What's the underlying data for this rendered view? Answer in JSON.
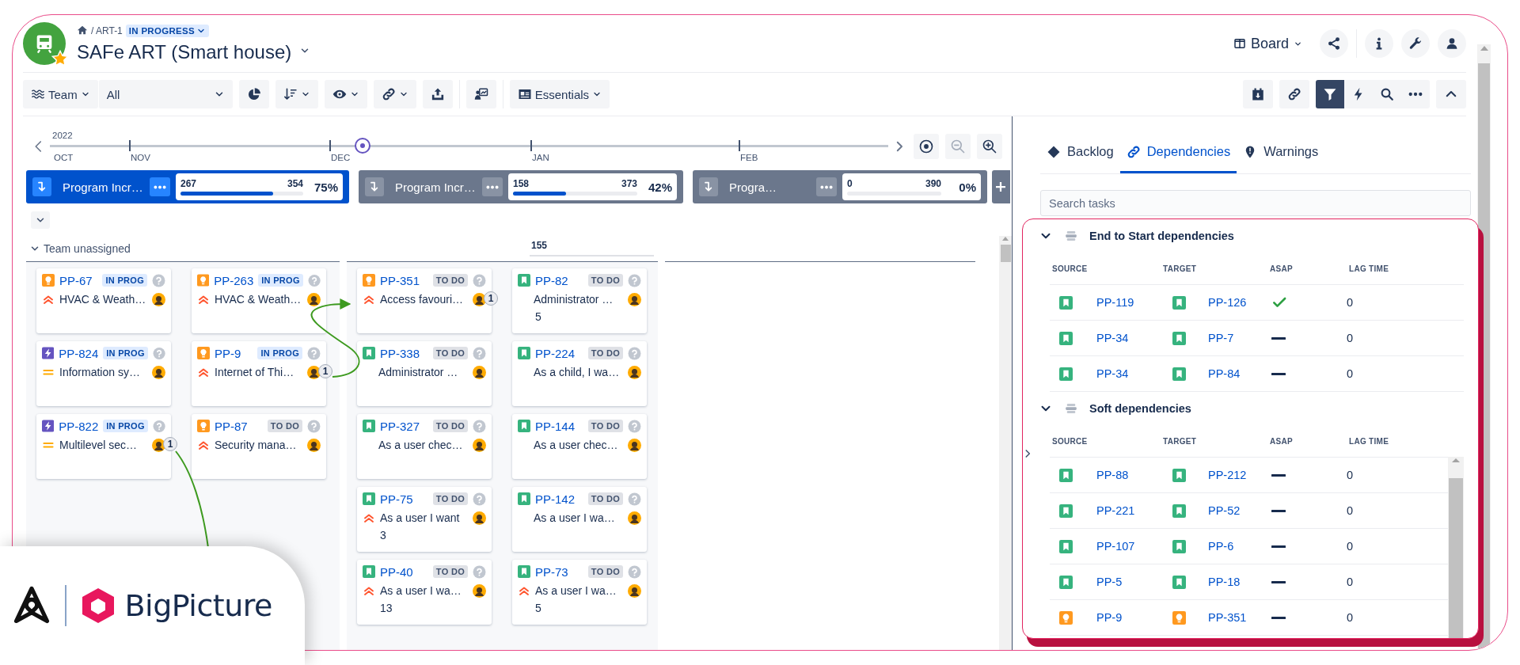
{
  "header": {
    "breadcrumb": "/ ART-1",
    "status": "IN PROGRESS",
    "title": "SAFe ART (Smart house)",
    "view": "Board"
  },
  "toolbar": {
    "team_label": "Team",
    "team_value": "All",
    "preset": "Essentials",
    "filter_active": true
  },
  "timeline": {
    "year": "2022",
    "months": [
      "OCT",
      "NOV",
      "DEC",
      "JAN",
      "FEB"
    ]
  },
  "program_increments": [
    {
      "title": "Program Incr…",
      "done": "267",
      "total": "354",
      "percent": "75%",
      "level": 0.754,
      "selected": true
    },
    {
      "title": "Program Incr…",
      "done": "158",
      "total": "373",
      "percent": "42%",
      "level": 0.424,
      "selected": false
    },
    {
      "title": "Progra…",
      "done": "0",
      "total": "390",
      "percent": "0%",
      "level": 0,
      "selected": false
    }
  ],
  "swimlane": {
    "title": "Team unassigned",
    "expanded": true,
    "capacity": "155"
  },
  "lanes": [
    {
      "cards": [
        {
          "key": "PP-67",
          "kind": "idea",
          "status": "IN PROG",
          "in_progress": true,
          "priority": {
            "kind": "highest"
          },
          "summary": "HVAC & Weath…"
        },
        {
          "key": "PP-263",
          "kind": "idea",
          "status": "IN PROG",
          "in_progress": true,
          "priority": {
            "kind": "highest"
          },
          "summary": "HVAC & Weath…"
        },
        {
          "key": "PP-824",
          "kind": "enabler",
          "status": "IN PROG",
          "in_progress": true,
          "priority": {
            "kind": "medium"
          },
          "summary": "Information sy…"
        },
        {
          "key": "PP-9",
          "kind": "idea",
          "status": "IN PROG",
          "in_progress": true,
          "priority": {
            "kind": "highest"
          },
          "summary": "Internet of Thi…",
          "links": "1"
        },
        {
          "key": "PP-822",
          "kind": "enabler",
          "status": "IN PROG",
          "in_progress": true,
          "priority": {
            "kind": "medium"
          },
          "summary": "Multilevel sec…",
          "links": "1"
        },
        {
          "key": "PP-87",
          "kind": "idea",
          "status": "TO DO",
          "in_progress": false,
          "priority": {
            "kind": "highest"
          },
          "summary": "Security mana…"
        }
      ]
    },
    {
      "cards": [
        {
          "key": "PP-351",
          "kind": "idea",
          "status": "TO DO",
          "in_progress": false,
          "priority": {
            "kind": "highest"
          },
          "summary": "Access favouri…",
          "links": "1"
        },
        {
          "key": "PP-82",
          "kind": "story",
          "status": "TO DO",
          "in_progress": false,
          "summary": "Administrator …",
          "points": "5"
        },
        {
          "key": "PP-338",
          "kind": "story",
          "status": "TO DO",
          "in_progress": false,
          "summary": "Administrator …"
        },
        {
          "key": "PP-224",
          "kind": "story",
          "status": "TO DO",
          "in_progress": false,
          "summary": "As a child, I wa…"
        },
        {
          "key": "PP-327",
          "kind": "story",
          "status": "TO DO",
          "in_progress": false,
          "summary": "As a user chec…"
        },
        {
          "key": "PP-144",
          "kind": "story",
          "status": "TO DO",
          "in_progress": false,
          "summary": "As a user chec…"
        },
        {
          "key": "PP-75",
          "kind": "story",
          "status": "TO DO",
          "in_progress": false,
          "priority": {
            "kind": "highest"
          },
          "summary": "As a user I want",
          "points": "3"
        },
        {
          "key": "PP-142",
          "kind": "story",
          "status": "TO DO",
          "in_progress": false,
          "summary": "As a user I wa…"
        },
        {
          "key": "PP-40",
          "kind": "story",
          "status": "TO DO",
          "in_progress": false,
          "priority": {
            "kind": "highest"
          },
          "summary": "As a user I wa…",
          "points": "13"
        },
        {
          "key": "PP-73",
          "kind": "story",
          "status": "TO DO",
          "in_progress": false,
          "priority": {
            "kind": "highest"
          },
          "summary": "As a user I wa…",
          "points": "5"
        }
      ]
    }
  ],
  "side_panel": {
    "tabs": [
      {
        "label": "Backlog",
        "kind": "backlog",
        "selected": false
      },
      {
        "label": "Dependencies",
        "kind": "dependencies",
        "selected": true
      },
      {
        "label": "Warnings",
        "kind": "warnings",
        "selected": false
      }
    ],
    "search_placeholder": "Search tasks",
    "sections": [
      {
        "title": "End to Start dependencies",
        "expanded": true,
        "columns": [
          "SOURCE",
          "TARGET",
          "ASAP",
          "LAG TIME"
        ],
        "rows": [
          {
            "source": {
              "key": "PP-119",
              "kind": "story"
            },
            "target": {
              "key": "PP-126",
              "kind": "story"
            },
            "asap": true,
            "lag_time": "0"
          },
          {
            "source": {
              "key": "PP-34",
              "kind": "story"
            },
            "target": {
              "key": "PP-7",
              "kind": "story"
            },
            "asap": false,
            "lag_time": "0"
          },
          {
            "source": {
              "key": "PP-34",
              "kind": "story"
            },
            "target": {
              "key": "PP-84",
              "kind": "story"
            },
            "asap": false,
            "lag_time": "0"
          }
        ]
      },
      {
        "title": "Soft dependencies",
        "expanded": true,
        "columns": [
          "SOURCE",
          "TARGET",
          "ASAP",
          "LAG TIME"
        ],
        "rows": [
          {
            "source": {
              "key": "PP-88",
              "kind": "story"
            },
            "target": {
              "key": "PP-212",
              "kind": "story"
            },
            "asap": false,
            "lag_time": "0"
          },
          {
            "source": {
              "key": "PP-221",
              "kind": "story"
            },
            "target": {
              "key": "PP-52",
              "kind": "story"
            },
            "asap": false,
            "lag_time": "0"
          },
          {
            "source": {
              "key": "PP-107",
              "kind": "story"
            },
            "target": {
              "key": "PP-6",
              "kind": "story"
            },
            "asap": false,
            "lag_time": "0"
          },
          {
            "source": {
              "key": "PP-5",
              "kind": "story"
            },
            "target": {
              "key": "PP-18",
              "kind": "story"
            },
            "asap": false,
            "lag_time": "0"
          },
          {
            "source": {
              "key": "PP-9",
              "kind": "idea"
            },
            "target": {
              "key": "PP-351",
              "kind": "idea"
            },
            "asap": false,
            "lag_time": "0"
          }
        ]
      }
    ]
  },
  "branding": {
    "name": "BigPicture"
  }
}
